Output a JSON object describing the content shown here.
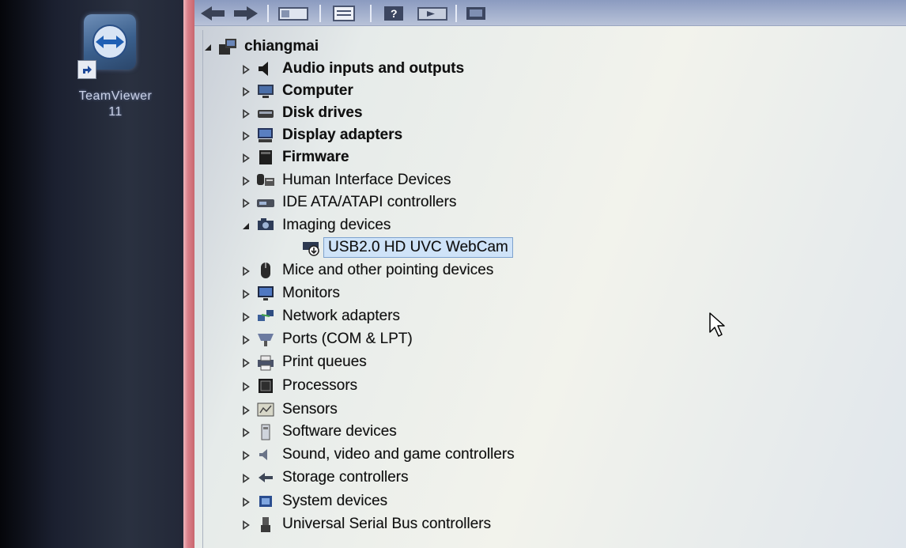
{
  "desktop": {
    "icon_label": "TeamViewer\n11"
  },
  "toolbar": {
    "buttons": [
      "back",
      "forward",
      "show-hide",
      "properties",
      "help",
      "update-driver",
      "scan"
    ]
  },
  "tree": {
    "root": "chiangmai",
    "items": [
      {
        "label": "Audio inputs and outputs",
        "icon": "speaker-icon"
      },
      {
        "label": "Computer",
        "icon": "computer-icon"
      },
      {
        "label": "Disk drives",
        "icon": "disk-drive-icon"
      },
      {
        "label": "Display adapters",
        "icon": "display-adapter-icon"
      },
      {
        "label": "Firmware",
        "icon": "firmware-icon"
      },
      {
        "label": "Human Interface Devices",
        "icon": "hid-icon"
      },
      {
        "label": "IDE ATA/ATAPI controllers",
        "icon": "ide-controller-icon"
      },
      {
        "label": "Imaging devices",
        "icon": "camera-icon",
        "expanded": true
      },
      {
        "label": "USB2.0 HD UVC WebCam",
        "icon": "webcam-icon",
        "selected": true
      },
      {
        "label": "Mice and other pointing devices",
        "icon": "mouse-icon"
      },
      {
        "label": "Monitors",
        "icon": "monitor-icon"
      },
      {
        "label": "Network adapters",
        "icon": "network-icon"
      },
      {
        "label": "Ports (COM & LPT)",
        "icon": "port-icon"
      },
      {
        "label": "Print queues",
        "icon": "printer-icon"
      },
      {
        "label": "Processors",
        "icon": "processor-icon"
      },
      {
        "label": "Sensors",
        "icon": "sensor-icon"
      },
      {
        "label": "Software devices",
        "icon": "software-device-icon"
      },
      {
        "label": "Sound, video and game controllers",
        "icon": "sound-icon"
      },
      {
        "label": "Storage controllers",
        "icon": "storage-icon"
      },
      {
        "label": "System devices",
        "icon": "system-icon"
      },
      {
        "label": "Universal Serial Bus controllers",
        "icon": "usb-icon"
      }
    ]
  },
  "colors": {
    "window_border": "#d9808a",
    "selection_bg": "#cfe3f8",
    "selection_border": "#7da2ce",
    "toolbar": "#8b9bc0"
  }
}
